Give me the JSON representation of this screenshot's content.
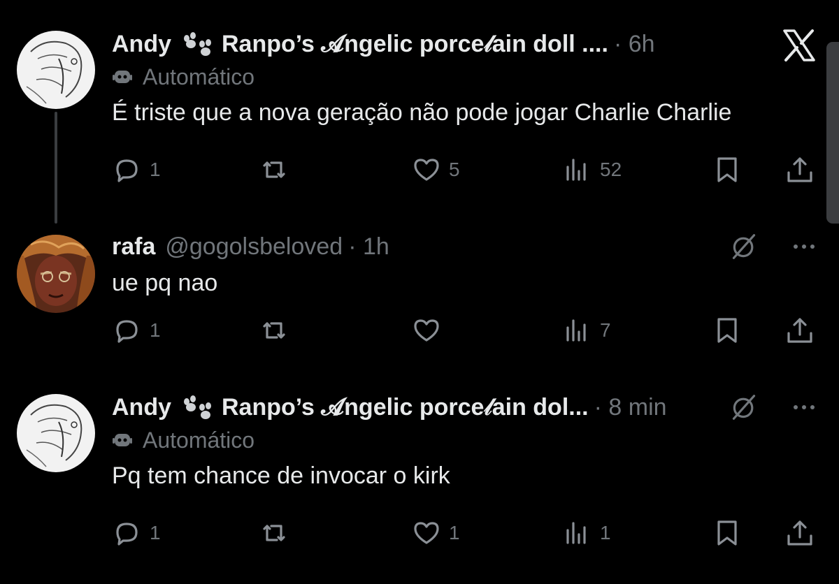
{
  "window": {
    "close_label": "X"
  },
  "posts": [
    {
      "author_name": "Andy",
      "display_name": "Ranpo’s 𝓐ngelic porce𝓁ain doll ....",
      "handle": "",
      "time": "· 6h",
      "automated_label": "Automático",
      "text": "É triste que a nova geração não pode jogar Charlie Charlie",
      "replies": "1",
      "reposts": "",
      "likes": "5",
      "views": "52"
    },
    {
      "author_name": "rafa",
      "display_name": "",
      "handle": "@gogolsbeloved",
      "time": "· 1h",
      "automated_label": "",
      "text": "ue pq nao",
      "replies": "1",
      "reposts": "",
      "likes": "",
      "views": "7"
    },
    {
      "author_name": "Andy",
      "display_name": "Ranpo’s 𝓐ngelic porce𝓁ain dol...",
      "handle": "",
      "time": "· 8 min",
      "automated_label": "Automático",
      "text": "Pq tem chance de invocar o kirk",
      "replies": "1",
      "reposts": "",
      "likes": "1",
      "views": "1"
    }
  ],
  "icons": {
    "reply": "reply-icon",
    "repost": "repost-icon",
    "like": "heart-icon",
    "views": "views-icon",
    "bookmark": "bookmark-icon",
    "share": "share-icon",
    "bot": "bot-icon",
    "paw": "paw-icon",
    "grok": "grok-icon",
    "more": "more-icon"
  },
  "colors": {
    "background": "#000000",
    "text": "#e7e9ea",
    "muted": "#71767b",
    "thread_line": "#3a3d40"
  }
}
